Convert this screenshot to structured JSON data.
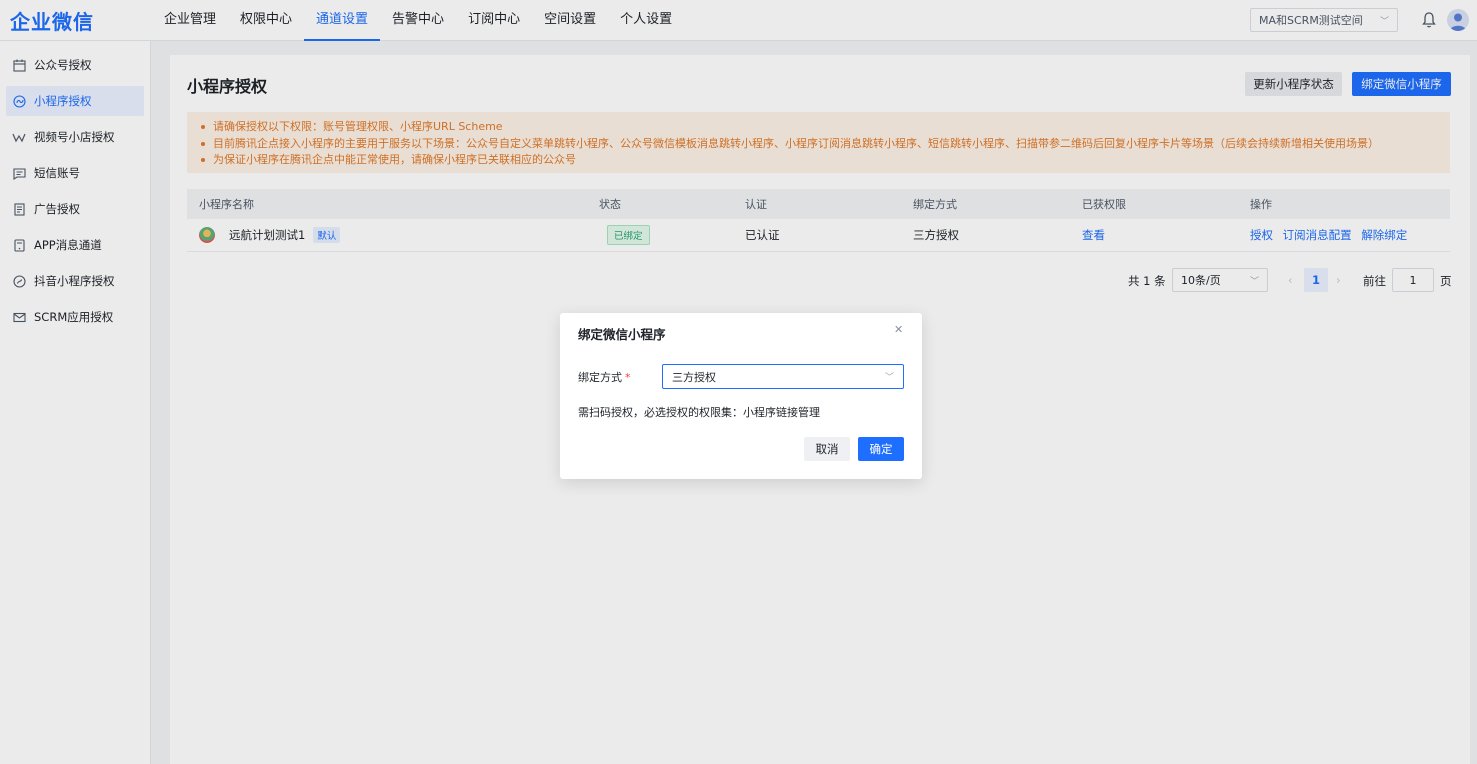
{
  "header": {
    "brand": "企业微信",
    "nav": [
      "企业管理",
      "权限中心",
      "通道设置",
      "告警中心",
      "订阅中心",
      "空间设置",
      "个人设置"
    ],
    "active_nav": "通道设置",
    "space_selector": "MA和SCRM测试空间"
  },
  "sidebar": {
    "items": [
      {
        "label": "公众号授权",
        "icon": "calendar-icon"
      },
      {
        "label": "小程序授权",
        "icon": "mini-program-icon"
      },
      {
        "label": "视频号小店授权",
        "icon": "video-channel-icon"
      },
      {
        "label": "短信账号",
        "icon": "sms-icon"
      },
      {
        "label": "广告授权",
        "icon": "ad-doc-icon"
      },
      {
        "label": "APP消息通道",
        "icon": "app-message-icon"
      },
      {
        "label": "抖音小程序授权",
        "icon": "douyin-icon"
      },
      {
        "label": "SCRM应用授权",
        "icon": "scrm-mail-icon"
      }
    ],
    "active": "小程序授权"
  },
  "main": {
    "title": "小程序授权",
    "refresh_button": "更新小程序状态",
    "bind_button": "绑定微信小程序",
    "notices": [
      "请确保授权以下权限：账号管理权限、小程序URL Scheme",
      "目前腾讯企点接入小程序的主要用于服务以下场景：公众号自定义菜单跳转小程序、公众号微信模板消息跳转小程序、小程序订阅消息跳转小程序、短信跳转小程序、扫描带参二维码后回复小程序卡片等场景（后续会持续新增相关使用场景）",
      "为保证小程序在腾讯企点中能正常使用，请确保小程序已关联相应的公众号"
    ],
    "table": {
      "columns": [
        "小程序名称",
        "状态",
        "认证",
        "绑定方式",
        "已获权限",
        "操作"
      ],
      "rows": [
        {
          "name": "远航计划测试1",
          "default_tag": "默认",
          "status": "已绑定",
          "certified": "已认证",
          "bind_method": "三方授权",
          "permissions_link": "查看",
          "actions": [
            "授权",
            "订阅消息配置",
            "解除绑定"
          ]
        }
      ]
    },
    "pagination": {
      "total": "共 1 条",
      "page_size": "10条/页",
      "current_page": "1",
      "goto_label": "前往",
      "goto_value": "1",
      "page_suffix": "页"
    }
  },
  "dialog": {
    "title": "绑定微信小程序",
    "field_label": "绑定方式",
    "field_value": "三方授权",
    "note": "需扫码授权，必选授权的权限集：小程序链接管理",
    "cancel": "取消",
    "confirm": "确定"
  }
}
